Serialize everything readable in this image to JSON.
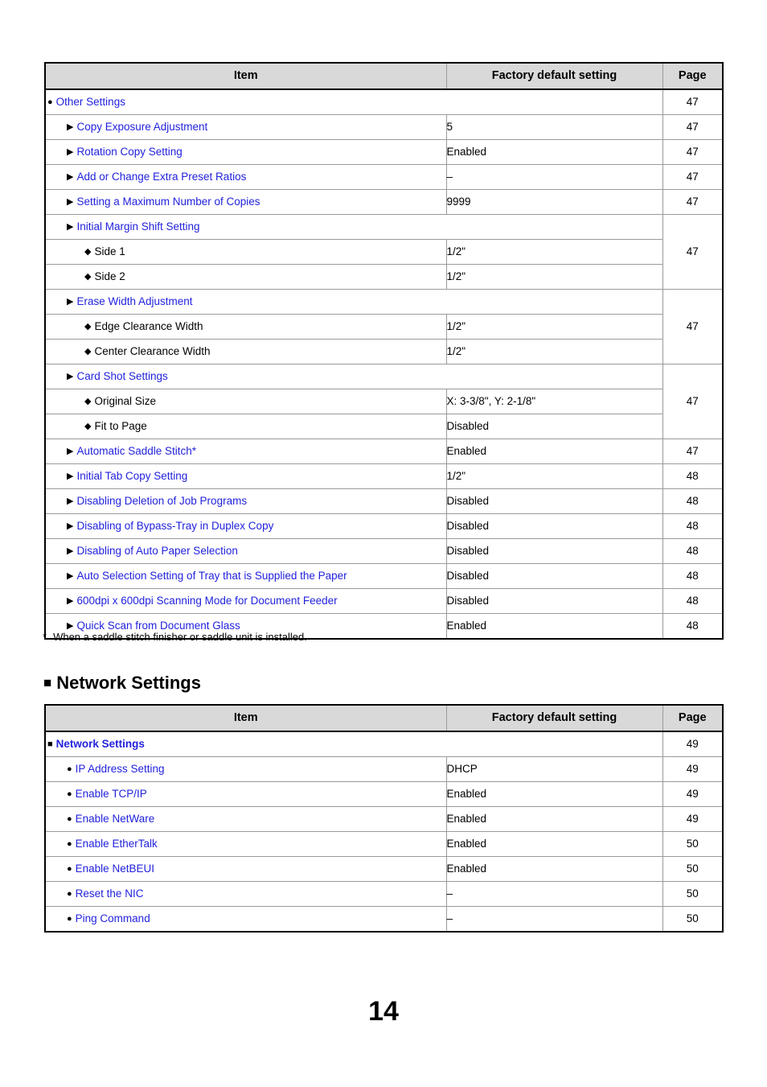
{
  "page": {
    "number": "14"
  },
  "markers": {
    "square": "■",
    "circle": "●",
    "triangle": "▶",
    "diamond": "◆",
    "star": "*"
  },
  "colors": {
    "link": "#2222dd",
    "header_background": "#d9d9d9",
    "border": "#9a9a9a",
    "outer_border": "#000000",
    "text": "#000000"
  },
  "table_headers": {
    "item": "Item",
    "factory_default_setting": "Factory default setting",
    "page": "Page"
  },
  "copy_settings_table": {
    "rows": [
      {
        "level": 0,
        "marker": "circle",
        "label": "Other Settings",
        "link": true,
        "bold": false,
        "value": null,
        "value_span": true,
        "page": "47",
        "page_rowspan": 1
      },
      {
        "level": 1,
        "marker": "triangle",
        "label": "Copy Exposure Adjustment",
        "link": true,
        "bold": false,
        "value": "5",
        "value_span": false,
        "page": "47",
        "page_rowspan": 1
      },
      {
        "level": 1,
        "marker": "triangle",
        "label": "Rotation Copy Setting",
        "link": true,
        "bold": false,
        "value": "Enabled",
        "value_span": false,
        "page": "47",
        "page_rowspan": 1
      },
      {
        "level": 1,
        "marker": "triangle",
        "label": "Add or Change Extra Preset Ratios",
        "link": true,
        "bold": false,
        "value": "–",
        "value_span": false,
        "page": "47",
        "page_rowspan": 1
      },
      {
        "level": 1,
        "marker": "triangle",
        "label": "Setting a Maximum Number of Copies",
        "link": true,
        "bold": false,
        "value": "9999",
        "value_span": false,
        "page": "47",
        "page_rowspan": 1
      },
      {
        "level": 1,
        "marker": "triangle",
        "label": "Initial Margin Shift Setting",
        "link": true,
        "bold": false,
        "value": null,
        "value_span": true,
        "page": "47",
        "page_rowspan": 3
      },
      {
        "level": 2,
        "marker": "diamond",
        "label": "Side 1",
        "link": false,
        "bold": false,
        "value": "1/2\"",
        "value_span": false,
        "page": null,
        "page_rowspan": 0
      },
      {
        "level": 2,
        "marker": "diamond",
        "label": "Side 2",
        "link": false,
        "bold": false,
        "value": "1/2\"",
        "value_span": false,
        "page": null,
        "page_rowspan": 0
      },
      {
        "level": 1,
        "marker": "triangle",
        "label": "Erase Width Adjustment",
        "link": true,
        "bold": false,
        "value": null,
        "value_span": true,
        "page": "47",
        "page_rowspan": 3
      },
      {
        "level": 2,
        "marker": "diamond",
        "label": "Edge Clearance Width",
        "link": false,
        "bold": false,
        "value": "1/2\"",
        "value_span": false,
        "page": null,
        "page_rowspan": 0
      },
      {
        "level": 2,
        "marker": "diamond",
        "label": "Center Clearance Width",
        "link": false,
        "bold": false,
        "value": "1/2\"",
        "value_span": false,
        "page": null,
        "page_rowspan": 0
      },
      {
        "level": 1,
        "marker": "triangle",
        "label": "Card Shot Settings",
        "link": true,
        "bold": false,
        "value": null,
        "value_span": true,
        "page": "47",
        "page_rowspan": 3
      },
      {
        "level": 2,
        "marker": "diamond",
        "label": "Original Size",
        "link": false,
        "bold": false,
        "value": "X: 3-3/8\", Y: 2-1/8\"",
        "value_span": false,
        "page": null,
        "page_rowspan": 0
      },
      {
        "level": 2,
        "marker": "diamond",
        "label": "Fit to Page",
        "link": false,
        "bold": false,
        "value": "Disabled",
        "value_span": false,
        "page": null,
        "page_rowspan": 0
      },
      {
        "level": 1,
        "marker": "triangle",
        "label": "Automatic Saddle Stitch*",
        "link": true,
        "bold": false,
        "value": "Enabled",
        "value_span": false,
        "page": "47",
        "page_rowspan": 1
      },
      {
        "level": 1,
        "marker": "triangle",
        "label": "Initial Tab Copy Setting",
        "link": true,
        "bold": false,
        "value": "1/2\"",
        "value_span": false,
        "page": "48",
        "page_rowspan": 1
      },
      {
        "level": 1,
        "marker": "triangle",
        "label": "Disabling Deletion of Job Programs",
        "link": true,
        "bold": false,
        "value": "Disabled",
        "value_span": false,
        "page": "48",
        "page_rowspan": 1
      },
      {
        "level": 1,
        "marker": "triangle",
        "label": "Disabling of Bypass-Tray in Duplex Copy",
        "link": true,
        "bold": false,
        "value": "Disabled",
        "value_span": false,
        "page": "48",
        "page_rowspan": 1
      },
      {
        "level": 1,
        "marker": "triangle",
        "label": "Disabling of Auto Paper Selection",
        "link": true,
        "bold": false,
        "value": "Disabled",
        "value_span": false,
        "page": "48",
        "page_rowspan": 1
      },
      {
        "level": 1,
        "marker": "triangle",
        "label": "Auto Selection Setting of Tray that is Supplied the Paper",
        "link": true,
        "bold": false,
        "value": "Disabled",
        "value_span": false,
        "page": "48",
        "page_rowspan": 1
      },
      {
        "level": 1,
        "marker": "triangle",
        "label": "600dpi x 600dpi Scanning Mode for Document Feeder",
        "link": true,
        "bold": false,
        "value": "Disabled",
        "value_span": false,
        "page": "48",
        "page_rowspan": 1
      },
      {
        "level": 1,
        "marker": "triangle",
        "label": "Quick Scan from Document Glass",
        "link": true,
        "bold": false,
        "value": "Enabled",
        "value_span": false,
        "page": "48",
        "page_rowspan": 1
      }
    ]
  },
  "footnote": {
    "marker": "*",
    "text": "When a saddle stitch finisher or saddle unit is installed."
  },
  "network_section": {
    "heading": "Network Settings",
    "rows": [
      {
        "level": 0,
        "marker": "square",
        "label": "Network Settings",
        "link": true,
        "bold": true,
        "value": null,
        "value_span": true,
        "page": "49",
        "page_rowspan": 1
      },
      {
        "level": 1,
        "marker": "circle",
        "label": "IP Address Setting",
        "link": true,
        "bold": false,
        "value": "DHCP",
        "value_span": false,
        "page": "49",
        "page_rowspan": 1
      },
      {
        "level": 1,
        "marker": "circle",
        "label": "Enable TCP/IP",
        "link": true,
        "bold": false,
        "value": "Enabled",
        "value_span": false,
        "page": "49",
        "page_rowspan": 1
      },
      {
        "level": 1,
        "marker": "circle",
        "label": "Enable NetWare",
        "link": true,
        "bold": false,
        "value": "Enabled",
        "value_span": false,
        "page": "49",
        "page_rowspan": 1
      },
      {
        "level": 1,
        "marker": "circle",
        "label": "Enable EtherTalk",
        "link": true,
        "bold": false,
        "value": "Enabled",
        "value_span": false,
        "page": "50",
        "page_rowspan": 1
      },
      {
        "level": 1,
        "marker": "circle",
        "label": "Enable NetBEUI",
        "link": true,
        "bold": false,
        "value": "Enabled",
        "value_span": false,
        "page": "50",
        "page_rowspan": 1
      },
      {
        "level": 1,
        "marker": "circle",
        "label": "Reset the NIC",
        "link": true,
        "bold": false,
        "value": "–",
        "value_span": false,
        "page": "50",
        "page_rowspan": 1
      },
      {
        "level": 1,
        "marker": "circle",
        "label": "Ping Command",
        "link": true,
        "bold": false,
        "value": "–",
        "value_span": false,
        "page": "50",
        "page_rowspan": 1
      }
    ]
  }
}
